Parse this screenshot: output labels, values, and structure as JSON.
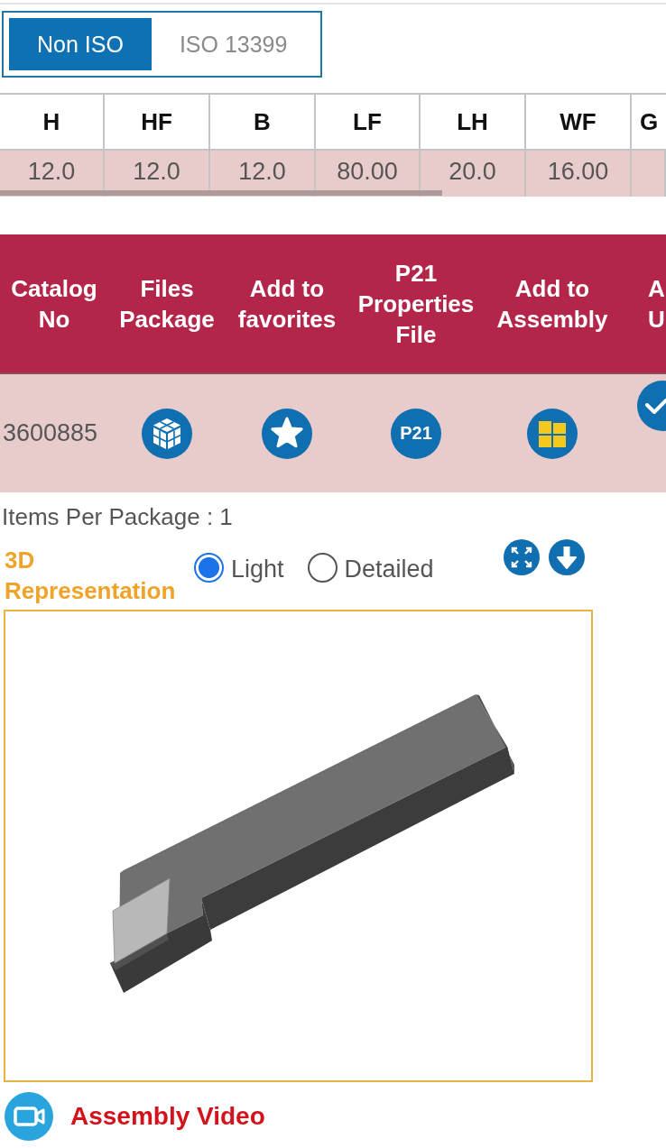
{
  "standard_toggle": [
    {
      "label": "Non ISO",
      "selected": true
    },
    {
      "label": "ISO 13399",
      "selected": false
    }
  ],
  "dimensions_table": {
    "columns": [
      "H",
      "HF",
      "B",
      "LF",
      "LH",
      "WF",
      "G"
    ],
    "rows": [
      [
        "12.0",
        "12.0",
        "12.0",
        "80.00",
        "20.0",
        "16.00"
      ]
    ]
  },
  "actions_table": {
    "columns": [
      "Catalog No",
      "Files Package",
      "Add to favorites",
      "P21 Properties File",
      "Add to Assembly",
      "A U"
    ],
    "rows": [
      {
        "cells": [
          {
            "kind": "text",
            "text": "3600885"
          },
          {
            "kind": "package"
          },
          {
            "kind": "favorite"
          },
          {
            "kind": "p21",
            "label": "P21"
          },
          {
            "kind": "assembly"
          },
          {
            "kind": "check"
          }
        ]
      }
    ]
  },
  "items_per_package": "Items Per Package : 1",
  "representation": {
    "title": "3D Representation",
    "options": [
      {
        "label": "Light",
        "selected": true
      },
      {
        "label": "Detailed",
        "selected": false
      }
    ],
    "tools": [
      {
        "kind": "expand"
      },
      {
        "kind": "download"
      }
    ]
  },
  "assembly_video": {
    "label": "Assembly Video"
  }
}
